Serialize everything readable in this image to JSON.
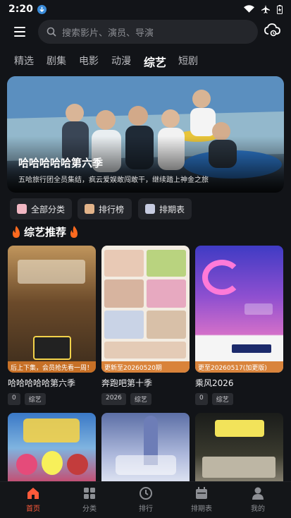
{
  "status": {
    "time": "2:20"
  },
  "search": {
    "placeholder": "搜索影片、演员、导演"
  },
  "tabs": [
    {
      "label": "精选",
      "active": false
    },
    {
      "label": "剧集",
      "active": false
    },
    {
      "label": "电影",
      "active": false
    },
    {
      "label": "动漫",
      "active": false
    },
    {
      "label": "综艺",
      "active": true
    },
    {
      "label": "短剧",
      "active": false
    }
  ],
  "hero": {
    "title": "哈哈哈哈哈第六季",
    "subtitle": "五哈旅行团全员集结，疯云爱娱敢闯敢干，继续踏上神金之旅"
  },
  "quick": [
    {
      "label": "全部分类"
    },
    {
      "label": "排行榜"
    },
    {
      "label": "排期表"
    }
  ],
  "section": {
    "title": "综艺推荐"
  },
  "cards": [
    {
      "title": "哈哈哈哈哈第六季",
      "badge": "后上下集，会员抢先看一周！",
      "tags": [
        "0",
        "综艺"
      ],
      "colors": [
        "#6b4a2a",
        "#a77b46",
        "#3c2c1c"
      ]
    },
    {
      "title": "奔跑吧第十季",
      "badge": "更新至20260520期",
      "tags": [
        "2026",
        "综艺"
      ],
      "colors": [
        "#f1e5d8",
        "#e8a7b9",
        "#cfd7e6"
      ]
    },
    {
      "title": "乘风2026",
      "badge": "更至20260517(加更版)",
      "tags": [
        "0",
        "综艺"
      ],
      "colors": [
        "#4a46c9",
        "#d46fc7",
        "#f1f1f1"
      ]
    },
    {
      "title": "",
      "colors": [
        "#3f7cc8",
        "#d0c45a",
        "#a7406f"
      ]
    },
    {
      "title": "",
      "colors": [
        "#6f7fb0",
        "#c6cee6",
        "#2b3a66"
      ]
    },
    {
      "title": "",
      "colors": [
        "#1c1e1c",
        "#4a4a3a",
        "#b6b0a0"
      ]
    }
  ],
  "nav": [
    {
      "label": "首页",
      "icon": "home-icon",
      "active": true
    },
    {
      "label": "分类",
      "icon": "grid-icon",
      "active": false
    },
    {
      "label": "排行",
      "icon": "ranking-icon",
      "active": false
    },
    {
      "label": "排期表",
      "icon": "calendar-icon",
      "active": false
    },
    {
      "label": "我的",
      "icon": "profile-icon",
      "active": false
    }
  ]
}
